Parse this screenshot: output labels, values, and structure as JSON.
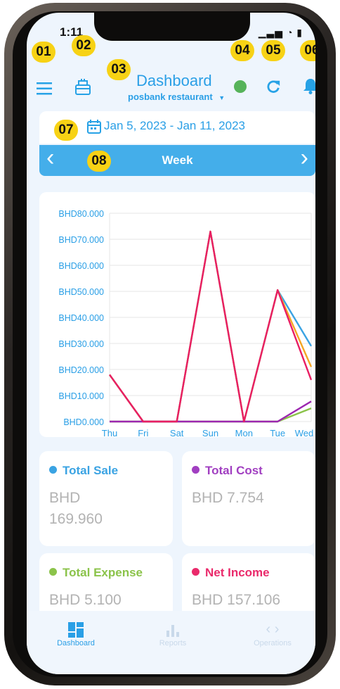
{
  "status_bar": {
    "time": "1:11",
    "icons": "▁▃▅ ◔ ▮"
  },
  "badges": [
    "01",
    "02",
    "03",
    "04",
    "05",
    "06",
    "07",
    "08"
  ],
  "header": {
    "title": "Dashboard",
    "subtitle": "posbank restaurant",
    "status_color": "#56b35a"
  },
  "date_range": {
    "text": "Jan 5, 2023 - Jan 11, 2023"
  },
  "period": {
    "label": "Week",
    "prev": "‹",
    "next": "›"
  },
  "chart_data": {
    "type": "line",
    "categories": [
      "Thu",
      "Fri",
      "Sat",
      "Sun",
      "Mon",
      "Tue",
      "Wed"
    ],
    "y_ticks": [
      "BHD0.000",
      "BHD10.000",
      "BHD20.000",
      "BHD30.000",
      "BHD40.000",
      "BHD50.000",
      "BHD60.000",
      "BHD70.000",
      "BHD80.000"
    ],
    "ylim": [
      0,
      80
    ],
    "grid": true,
    "series": [
      {
        "color": "#3aa3e3",
        "values": [
          18,
          0,
          0,
          73,
          0,
          50.5,
          29
        ]
      },
      {
        "color": "#f5a623",
        "values": [
          18,
          0,
          0,
          73,
          0,
          50.5,
          21
        ]
      },
      {
        "color": "#8bc34a",
        "values": [
          0,
          0,
          0,
          0,
          0,
          0,
          5.1
        ]
      },
      {
        "color": "#9c27b0",
        "values": [
          0,
          0,
          0,
          0,
          0,
          0,
          7.75
        ]
      },
      {
        "color": "#e91e63",
        "values": [
          18,
          0,
          0,
          73,
          0,
          50.5,
          16
        ]
      }
    ]
  },
  "stats": {
    "total_sale": {
      "label": "Total Sale",
      "value": "BHD 169.960",
      "color": "#3aa3e3"
    },
    "total_cost": {
      "label": "Total Cost",
      "value": "BHD 7.754",
      "color": "#a13fc1"
    },
    "total_expense": {
      "label": "Total Expense",
      "value": "BHD 5.100",
      "color": "#8bc34a"
    },
    "net_income": {
      "label": "Net Income",
      "value": "BHD 157.106",
      "color": "#ea2a6b"
    }
  },
  "bottom_nav": [
    {
      "label": "Dashboard",
      "icon": "dashboard-icon",
      "active": true
    },
    {
      "label": "Reports",
      "icon": "bar-chart-icon",
      "active": false
    },
    {
      "label": "Operations",
      "icon": "code-brackets-icon",
      "active": false
    }
  ]
}
